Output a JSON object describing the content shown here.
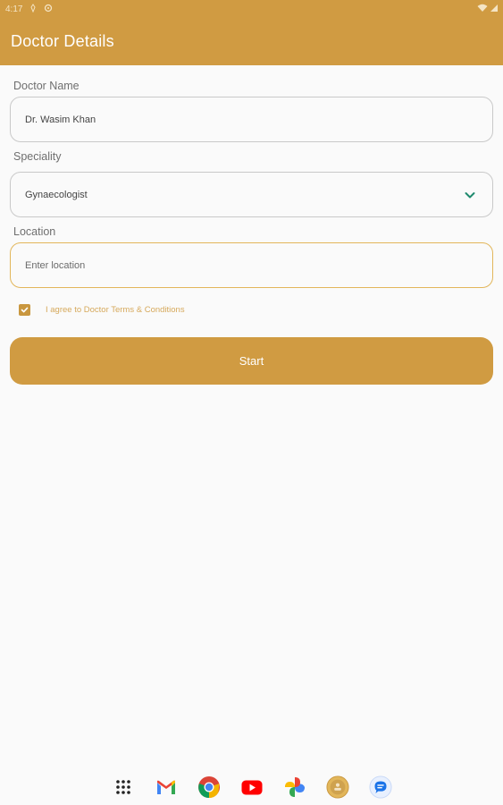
{
  "status_bar": {
    "time": "4:17"
  },
  "app_bar": {
    "title": "Doctor Details"
  },
  "form": {
    "doctor_name": {
      "label": "Doctor Name",
      "value": "Dr. Wasim Khan"
    },
    "speciality": {
      "label": "Speciality",
      "value": "Gynaecologist"
    },
    "location": {
      "label": "Location",
      "placeholder": "Enter location"
    },
    "terms": {
      "label": "I agree to Doctor Terms & Conditions",
      "checked": true
    },
    "start_button": {
      "label": "Start"
    }
  },
  "colors": {
    "primary": "#d09b42",
    "accent_text": "#d6a95c",
    "chevron": "#1f8a6e"
  },
  "dock": {
    "apps": [
      "app-drawer-icon",
      "gmail-icon",
      "chrome-icon",
      "youtube-icon",
      "photos-icon",
      "app-logo-icon",
      "messages-icon"
    ]
  }
}
